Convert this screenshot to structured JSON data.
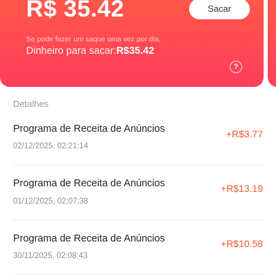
{
  "balance": {
    "amount": "R$ 35.42",
    "withdraw_label": "Sacar",
    "notice": "Se pode fazer um saque uma vez por dia.",
    "withdrawable_label": "Dinheiro para sacar:",
    "withdrawable_amount": "R$35.42",
    "help_icon": "question-circle-icon",
    "help_glyph": "?"
  },
  "details": {
    "title": "Detalhes",
    "items": [
      {
        "title": "Programa de Receita de Anúncios",
        "date": "02/12/2025, 02:21:14",
        "amount": "+R$3.77"
      },
      {
        "title": "Programa de Receita de Anúncios",
        "date": "01/12/2025, 02:07:38",
        "amount": "+R$13.19"
      },
      {
        "title": "Programa de Receita de Anúncios",
        "date": "30/11/2025, 02:08:43",
        "amount": "+R$10.58"
      }
    ]
  },
  "colors": {
    "card_gradient_top": "#ff5c45",
    "card_gradient_bottom": "#ff3f5e",
    "amount_positive": "#f05a28"
  }
}
